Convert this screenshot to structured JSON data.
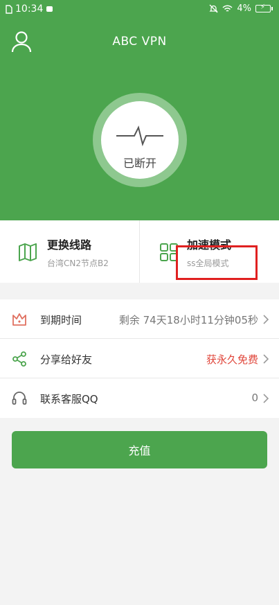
{
  "status_bar": {
    "time": "10:34",
    "battery": "4%"
  },
  "header": {
    "title": "ABC VPN"
  },
  "connection": {
    "status": "已断开"
  },
  "cards": [
    {
      "title": "更换线路",
      "subtitle": "台湾CN2节点B2"
    },
    {
      "title": "加速模式",
      "subtitle": "ss全局模式"
    }
  ],
  "list": [
    {
      "label": "到期时间",
      "value": "剩余 74天18小时11分钟05秒"
    },
    {
      "label": "分享给好友",
      "value": "获永久免费"
    },
    {
      "label": "联系客服QQ",
      "value": "0"
    }
  ],
  "button": {
    "label": "充值"
  },
  "colors": {
    "primary_green": "#4ca54e",
    "highlight_red": "#e02020",
    "promo_red": "#e0453a"
  }
}
